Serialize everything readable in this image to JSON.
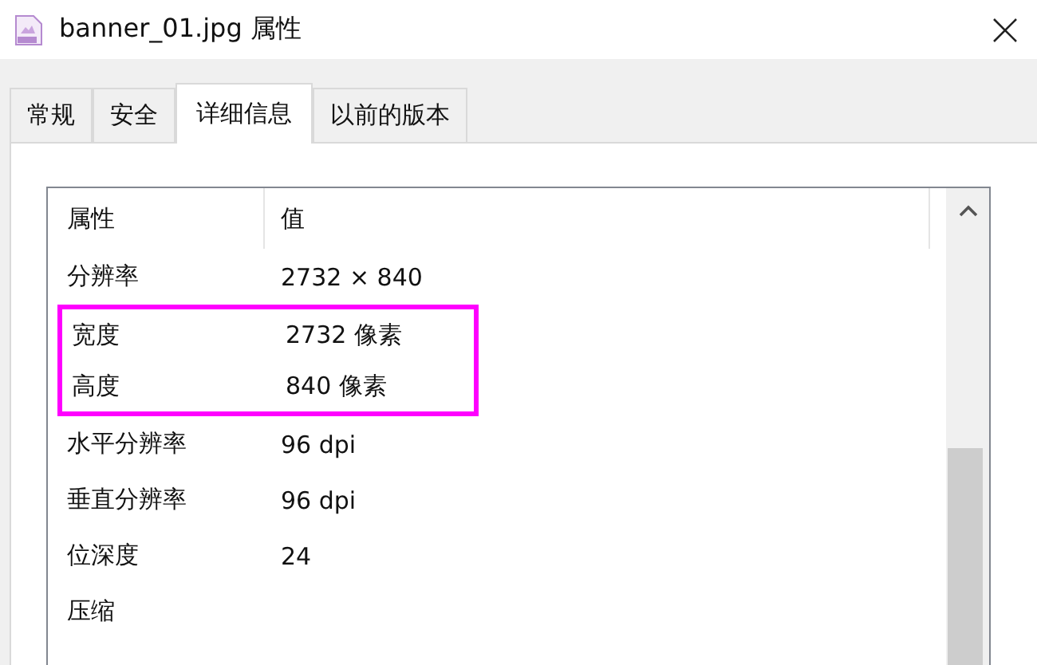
{
  "window": {
    "title": "banner_01.jpg 属性"
  },
  "tabs": [
    {
      "label": "常规",
      "selected": false
    },
    {
      "label": "安全",
      "selected": false
    },
    {
      "label": "详细信息",
      "selected": true
    },
    {
      "label": "以前的版本",
      "selected": false
    }
  ],
  "table": {
    "columns": [
      "属性",
      "值"
    ],
    "rows": [
      {
        "name": "分辨率",
        "value": "2732 × 840",
        "highlighted": false
      },
      {
        "name": "宽度",
        "value": "2732 像素",
        "highlighted": true
      },
      {
        "name": "高度",
        "value": "840 像素",
        "highlighted": true
      },
      {
        "name": "水平分辨率",
        "value": "96 dpi",
        "highlighted": false
      },
      {
        "name": "垂直分辨率",
        "value": "96 dpi",
        "highlighted": false
      },
      {
        "name": "位深度",
        "value": "24",
        "highlighted": false
      },
      {
        "name": "压缩",
        "highlighted": false
      }
    ]
  }
}
